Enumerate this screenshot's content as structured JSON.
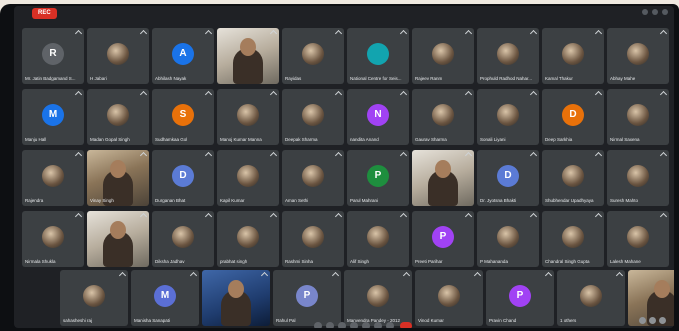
{
  "recording_label": "REC",
  "rows": [
    {
      "tiles": [
        {
          "type": "letter",
          "letter": "R",
          "color": "#5f6368",
          "name": "Mr. Jatin Badgamand S..."
        },
        {
          "type": "photo",
          "name": "H Jabari"
        },
        {
          "type": "letter",
          "letter": "A",
          "color": "#1a73e8",
          "name": "Abhilash Nayak"
        },
        {
          "type": "video",
          "style": "light",
          "name": ""
        },
        {
          "type": "photo",
          "name": "Rayidas"
        },
        {
          "type": "letter",
          "letter": "",
          "color": "#12a4af",
          "name": "National Centre for Seis..."
        },
        {
          "type": "photo",
          "name": "Rajeev Ranm"
        },
        {
          "type": "photo",
          "name": "Prophuld Radhod Nahar..."
        },
        {
          "type": "photo",
          "name": "Kamal Thakur"
        },
        {
          "type": "photo",
          "name": "Abhay Mahe"
        }
      ]
    },
    {
      "tiles": [
        {
          "type": "letter",
          "letter": "M",
          "color": "#1a73e8",
          "name": "Manju Hall"
        },
        {
          "type": "photo",
          "name": "Madan Gopal Singh"
        },
        {
          "type": "letter",
          "letter": "S",
          "color": "#e8710a",
          "name": "Sudhamkaa Gol"
        },
        {
          "type": "photo",
          "name": "Manoj Kumar Manna"
        },
        {
          "type": "photo",
          "name": "Deepak Sharma"
        },
        {
          "type": "letter",
          "letter": "N",
          "color": "#a142f4",
          "name": "nandita Anand"
        },
        {
          "type": "photo",
          "name": "Gaurav Sharma"
        },
        {
          "type": "photo",
          "name": "Sonali Liyani"
        },
        {
          "type": "letter",
          "letter": "D",
          "color": "#e8710a",
          "name": "Deep Sarkhia"
        },
        {
          "type": "photo",
          "name": "Nirmal Saxena"
        }
      ]
    },
    {
      "tiles": [
        {
          "type": "photo",
          "name": "Rajendra"
        },
        {
          "type": "video",
          "style": "warm",
          "name": "Vinay Singh"
        },
        {
          "type": "letter",
          "letter": "D",
          "color": "#5b7bd5",
          "name": "Durganan Bhat"
        },
        {
          "type": "photo",
          "name": "Kapil Kumar"
        },
        {
          "type": "photo",
          "name": "Aman Sethi"
        },
        {
          "type": "letter",
          "letter": "P",
          "color": "#1e8e3e",
          "name": "Parul Mahrani"
        },
        {
          "type": "video",
          "style": "light",
          "name": ""
        },
        {
          "type": "letter",
          "letter": "D",
          "color": "#5b7bd5",
          "name": "Dr. Jyotsna Bhakti"
        },
        {
          "type": "photo",
          "name": "Shubhendar Upadhyaya"
        },
        {
          "type": "photo",
          "name": "Suresh Mahto"
        }
      ]
    },
    {
      "tiles": [
        {
          "type": "photo",
          "name": "Nirmala Shukla"
        },
        {
          "type": "video",
          "style": "light",
          "name": ""
        },
        {
          "type": "photo",
          "name": "Diksha Jadhav"
        },
        {
          "type": "photo",
          "name": "prabhat singh"
        },
        {
          "type": "photo",
          "name": "Rashmi Sinha"
        },
        {
          "type": "photo",
          "name": "Alif Singh"
        },
        {
          "type": "letter",
          "letter": "P",
          "color": "#a142f4",
          "name": "Preeti Parihar"
        },
        {
          "type": "photo",
          "name": "P Mahananda"
        },
        {
          "type": "photo",
          "name": "Chandral Singh Gupta"
        },
        {
          "type": "photo",
          "name": "Lalesh Mahane"
        }
      ]
    },
    {
      "tiles": [
        {
          "type": "photo",
          "name": "sahasheshi raj"
        },
        {
          "type": "letter",
          "letter": "M",
          "color": "#5b6fd5",
          "name": "Manisha Sanapati"
        },
        {
          "type": "video",
          "style": "blue",
          "name": ""
        },
        {
          "type": "letter",
          "letter": "P",
          "color": "#7986cb",
          "name": "Rahul Pal"
        },
        {
          "type": "photo",
          "name": "Manvendra Pandey - 2012"
        },
        {
          "type": "photo",
          "name": "Vinod Kumar"
        },
        {
          "type": "letter",
          "letter": "P",
          "color": "#a142f4",
          "name": "Pravin Chand"
        },
        {
          "type": "photo",
          "name": "1 others"
        },
        {
          "type": "video",
          "style": "warm",
          "name": ""
        }
      ]
    }
  ]
}
